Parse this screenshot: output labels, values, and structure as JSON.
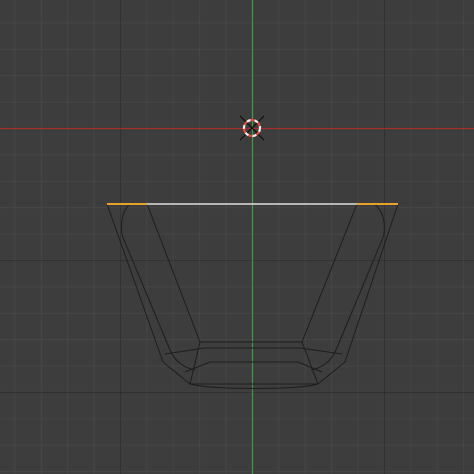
{
  "viewport": {
    "background": "#3d3d3d",
    "x_axis_color": "#a52e2e",
    "y_axis_color": "#3f9b3f",
    "wire_color": "#1e1e1e",
    "selected_edge_color": "#e0e0e0",
    "selected_vertex_color": "#e6a22c",
    "cursor_ring_color_a": "#e84a3a",
    "cursor_ring_color_b": "#f0f0f0",
    "cursor_icon": "3d-cursor-icon",
    "object": "bowl-wireframe"
  }
}
